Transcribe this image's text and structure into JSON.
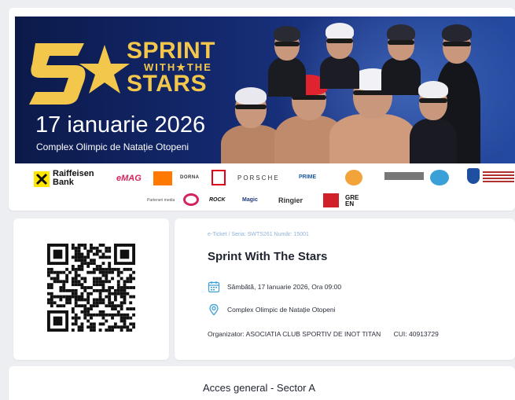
{
  "banner": {
    "title_line1": "SPRINT",
    "title_line2": "WITH★THE",
    "title_line3": "STARS",
    "date": "17 ianuarie 2026",
    "venue": "Complex Olimpic de Natație Otopeni"
  },
  "sponsors": {
    "raiffeisen_1": "Raiffeisen",
    "raiffeisen_2": "Bank",
    "emag": "eMAG",
    "dorna": "DORNA",
    "porsche": "PORSCHE",
    "prime": "PRIME",
    "ringier": "Ringier",
    "rock": "ROCK",
    "magic": "Magic",
    "green": "GRE EN",
    "partner_media": "Parteneri media"
  },
  "ticket": {
    "series": "e-Ticket / Seria: SWTS261 Număr: 15001",
    "event_title": "Sprint With The Stars",
    "datetime": "Sâmbătă, 17 Ianuarie 2026, Ora 09:00",
    "location": "Complex Olimpic de Natație Otopeni",
    "organizer": "Organizator: ASOCIATIA CLUB SPORTIV DE INOT TITAN",
    "cui": "CUI: 40913729"
  },
  "access": {
    "label": "Acces general - Sector A"
  },
  "icons": {
    "calendar": "calendar-icon",
    "location": "location-pin-icon",
    "qr": "qr-code"
  },
  "colors": {
    "accent": "#f3c74b",
    "banner_bg": "#13286d",
    "icon_blue": "#3aa0d8",
    "background": "#eceef2"
  }
}
